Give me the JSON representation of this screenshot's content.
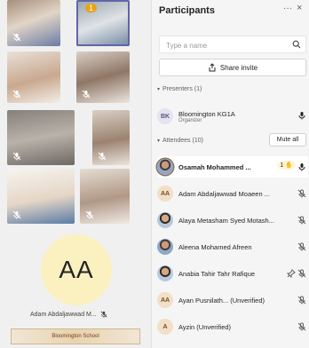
{
  "gallery": {
    "reaction_count": "1",
    "big_tile_initials": "AA",
    "big_tile_name": "Adam Abdaljawwad M...",
    "banner_text": "Bloomington School"
  },
  "panel": {
    "title": "Participants",
    "more": "···",
    "close": "×",
    "search_placeholder": "Type a name",
    "share_label": "Share invite",
    "presenters_header": "Presenters (1)",
    "attendees_header": "Attendees (10)",
    "mute_all": "Mute all",
    "presenter": {
      "initials": "BK",
      "name": "Bloomington KG1A",
      "role": "Organizer"
    },
    "attendees": [
      {
        "initials": "",
        "name": "Osamah Mohammed ...",
        "hand": "1"
      },
      {
        "initials": "AA",
        "name": "Adam Abdaljawwad Moaeen ..."
      },
      {
        "initials": "",
        "name": "Alaya Metasham Syed Motash..."
      },
      {
        "initials": "",
        "name": "Aleena Mohamed Afreen"
      },
      {
        "initials": "",
        "name": "Anabia Tahir Tahr Rafique"
      },
      {
        "initials": "AA",
        "name": "Ayan Pusnilath... (Unverified)"
      },
      {
        "initials": "A",
        "name": "Ayzin (Unverified)"
      }
    ]
  },
  "colors": {
    "accent": "#6264a7",
    "avatar_bg": "#fbf1c0",
    "hand": "#e8a317"
  }
}
